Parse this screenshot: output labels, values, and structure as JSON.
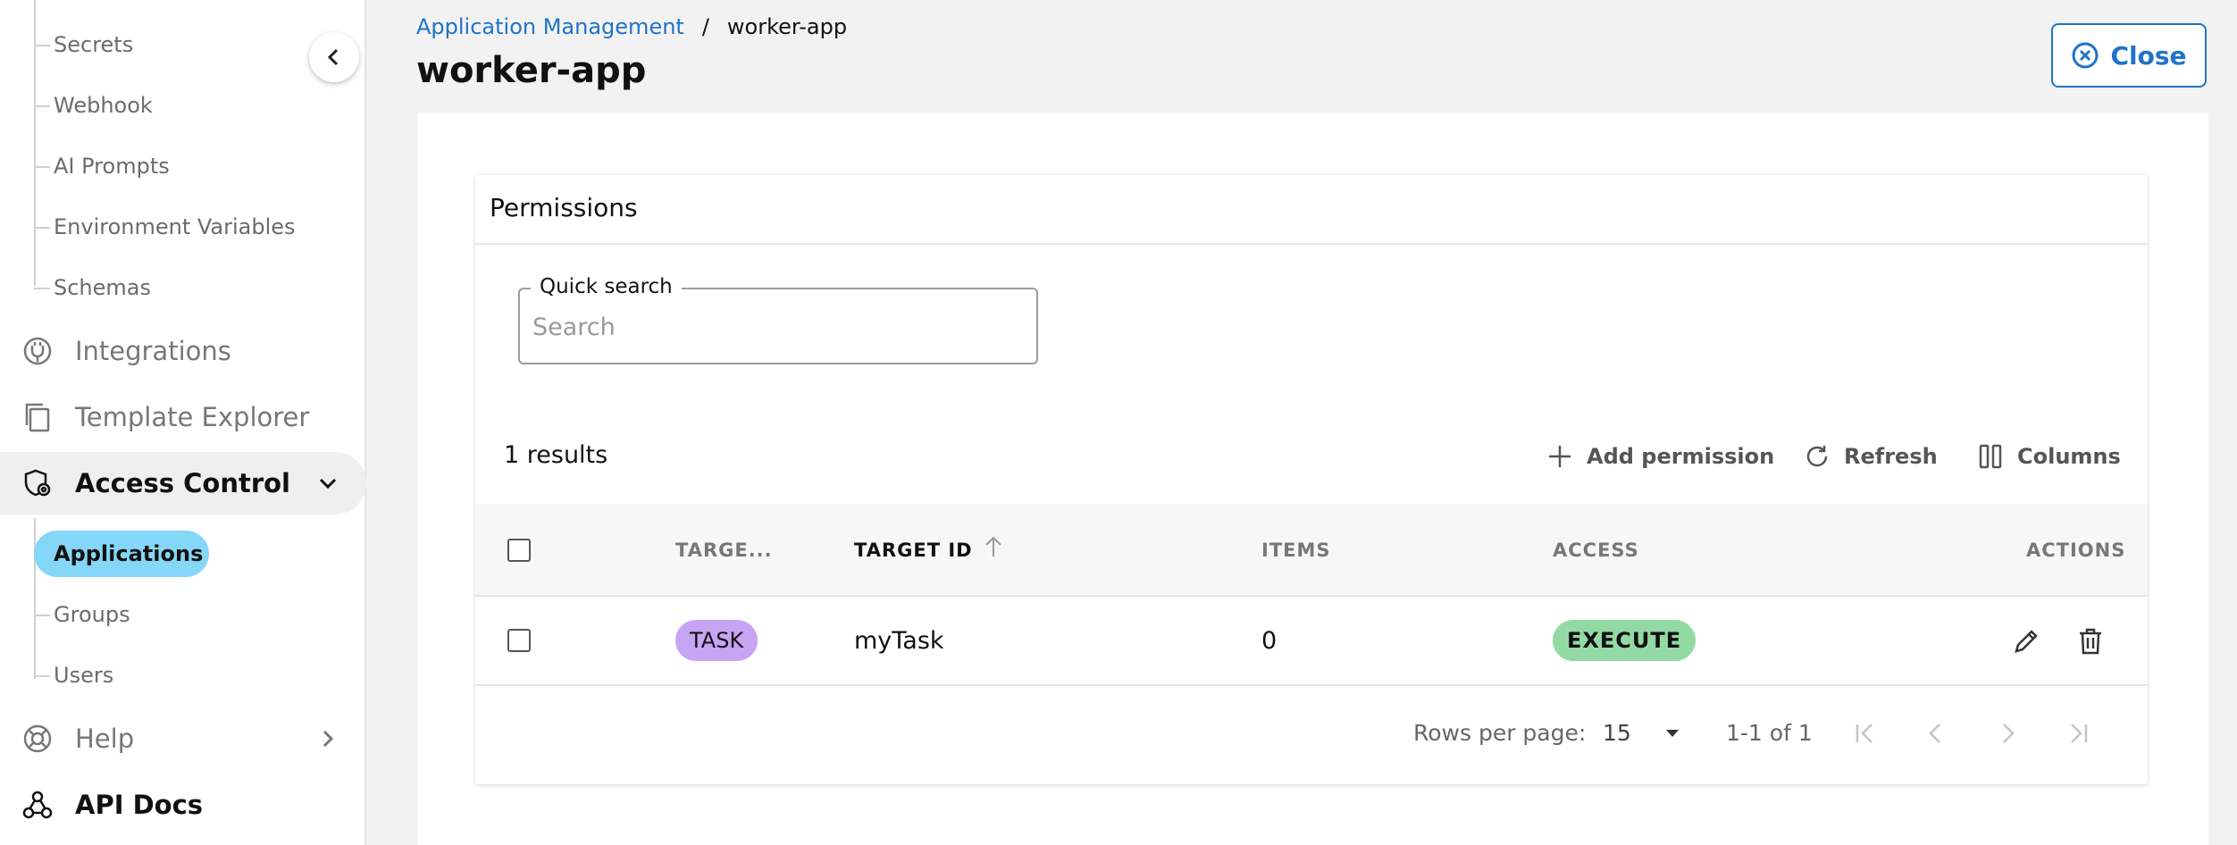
{
  "sidebar": {
    "sub_items_top": [
      {
        "label": "Secrets"
      },
      {
        "label": "Webhook"
      },
      {
        "label": "AI Prompts"
      },
      {
        "label": "Environment Variables"
      },
      {
        "label": "Schemas"
      }
    ],
    "nav": {
      "integrations": "Integrations",
      "template_explorer": "Template Explorer",
      "access_control": "Access Control",
      "help": "Help",
      "api_docs": "API Docs"
    },
    "access_sub": {
      "applications": "Applications",
      "groups": "Groups",
      "users": "Users"
    }
  },
  "header": {
    "breadcrumb_link": "Application Management",
    "breadcrumb_sep": "/",
    "breadcrumb_current": "worker-app",
    "title": "worker-app",
    "close_label": "Close"
  },
  "permissions": {
    "title": "Permissions",
    "search_legend": "Quick search",
    "search_placeholder": "Search",
    "results": "1 results",
    "toolbar": {
      "add": "Add permission",
      "refresh": "Refresh",
      "columns": "Columns"
    },
    "columns": {
      "target_type": "TARGE...",
      "target_id": "TARGET ID",
      "items": "ITEMS",
      "access": "ACCESS",
      "actions": "ACTIONS"
    },
    "rows": [
      {
        "target_type": "TASK",
        "target_id": "myTask",
        "items": "0",
        "access": "EXECUTE"
      }
    ],
    "footer": {
      "rows_per_page_label": "Rows per page:",
      "rows_per_page_value": "15",
      "range": "1-1 of 1"
    }
  },
  "colors": {
    "link": "#1f73c7",
    "active_pill": "#84d7f7",
    "task_chip": "#c7a4f4",
    "execute_chip": "#93d9a3"
  }
}
